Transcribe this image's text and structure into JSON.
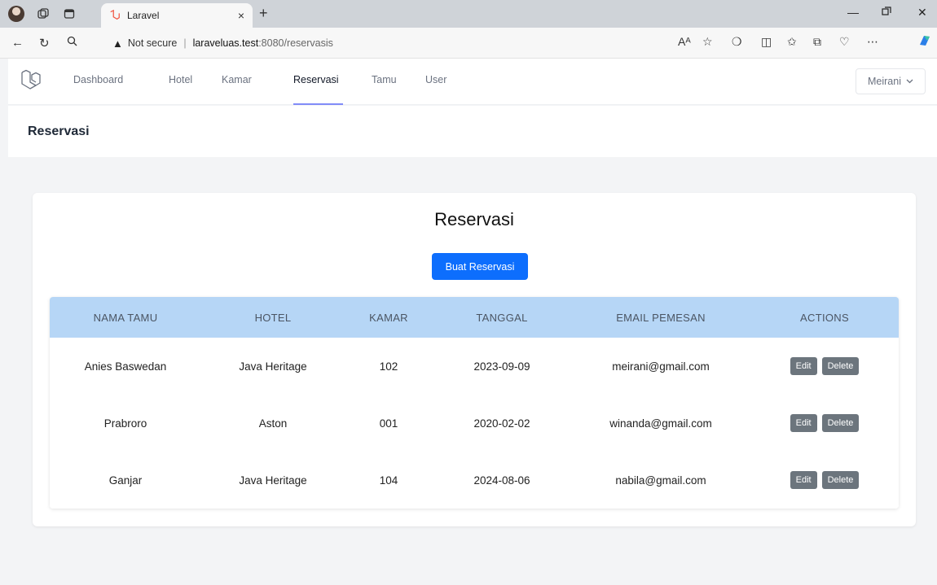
{
  "browser": {
    "tab_title": "Laravel",
    "tab_close": "×",
    "new_tab": "+",
    "security_label": "Not secure",
    "url_host": "laraveluas.test",
    "url_path": ":8080/reservasis",
    "read_aloud": "Aᴬ"
  },
  "nav": {
    "links": [
      "Dashboard",
      "Hotel",
      "Kamar",
      "Reservasi",
      "Tamu",
      "User"
    ],
    "active": "Reservasi",
    "user": "Meirani"
  },
  "header": {
    "title": "Reservasi"
  },
  "card": {
    "title": "Reservasi",
    "create_label": "Buat Reservasi"
  },
  "table": {
    "headers": [
      "NAMA TAMU",
      "HOTEL",
      "KAMAR",
      "TANGGAL",
      "EMAIL PEMESAN",
      "ACTIONS"
    ],
    "rows": [
      {
        "nama": "Anies Baswedan",
        "hotel": "Java Heritage",
        "kamar": "102",
        "tanggal": "2023-09-09",
        "email": "meirani@gmail.com"
      },
      {
        "nama": "Prabroro",
        "hotel": "Aston",
        "kamar": "001",
        "tanggal": "2020-02-02",
        "email": "winanda@gmail.com"
      },
      {
        "nama": "Ganjar",
        "hotel": "Java Heritage",
        "kamar": "104",
        "tanggal": "2024-08-06",
        "email": "nabila@gmail.com"
      }
    ],
    "edit_label": "Edit",
    "delete_label": "Delete"
  },
  "colors": {
    "primary": "#0d6efd",
    "table_header": "#b6d6f6",
    "secondary": "#6c757d",
    "nav_active": "#818cf8"
  }
}
